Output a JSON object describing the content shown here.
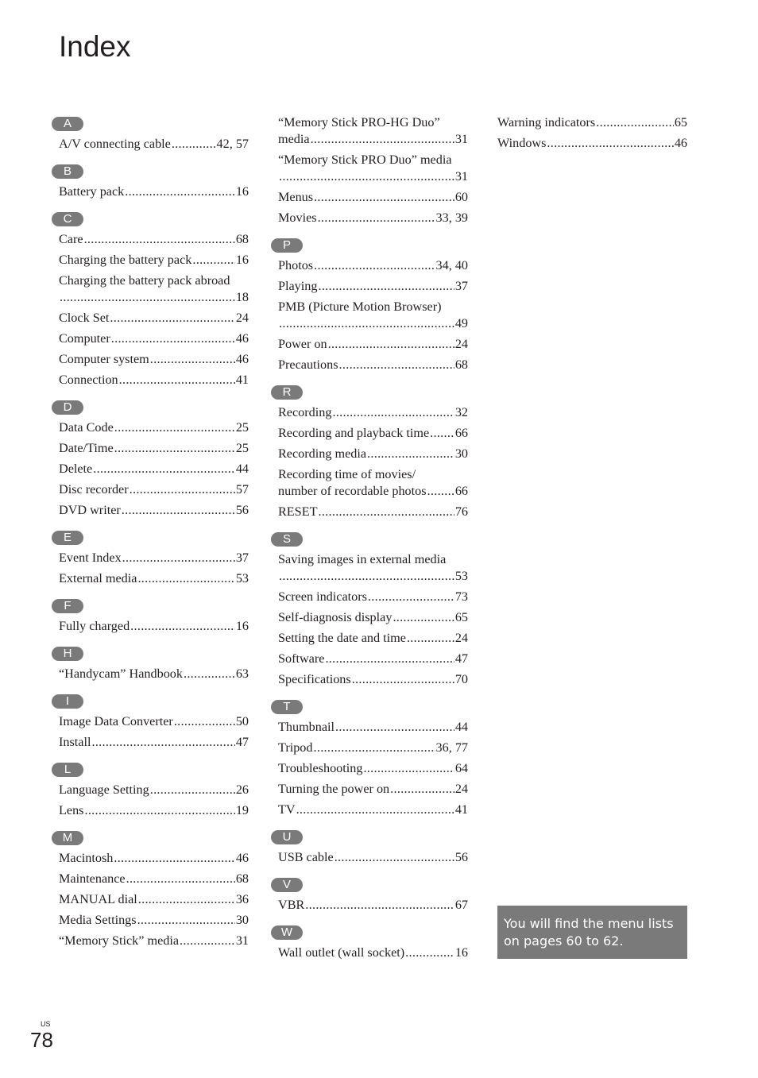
{
  "title": "Index",
  "columns": [
    {
      "sections": [
        {
          "letter": "A",
          "entries": [
            {
              "term": "A/V connecting cable",
              "page": "42, 57"
            }
          ]
        },
        {
          "letter": "B",
          "entries": [
            {
              "term": "Battery pack",
              "page": "16"
            }
          ]
        },
        {
          "letter": "C",
          "entries": [
            {
              "term": "Care",
              "page": "68"
            },
            {
              "term": "Charging the battery pack",
              "page": "16"
            },
            {
              "term": "Charging the battery pack abroad",
              "page": "18",
              "wrap": true
            },
            {
              "term": "Clock Set",
              "page": "24"
            },
            {
              "term": "Computer",
              "page": "46"
            },
            {
              "term": "Computer system",
              "page": "46"
            },
            {
              "term": "Connection",
              "page": "41"
            }
          ]
        },
        {
          "letter": "D",
          "entries": [
            {
              "term": "Data Code",
              "page": "25"
            },
            {
              "term": "Date/Time",
              "page": "25"
            },
            {
              "term": "Delete",
              "page": "44"
            },
            {
              "term": "Disc recorder",
              "page": "57"
            },
            {
              "term": "DVD writer",
              "page": "56"
            }
          ]
        },
        {
          "letter": "E",
          "entries": [
            {
              "term": "Event Index",
              "page": "37"
            },
            {
              "term": "External media",
              "page": "53"
            }
          ]
        },
        {
          "letter": "F",
          "entries": [
            {
              "term": "Fully charged",
              "page": "16"
            }
          ]
        },
        {
          "letter": "H",
          "entries": [
            {
              "term": "“Handycam” Handbook",
              "page": "63"
            }
          ]
        },
        {
          "letter": "I",
          "entries": [
            {
              "term": "Image Data Converter",
              "page": "50"
            },
            {
              "term": "Install",
              "page": "47"
            }
          ]
        },
        {
          "letter": "L",
          "entries": [
            {
              "term": "Language Setting",
              "page": "26"
            },
            {
              "term": "Lens",
              "page": "19"
            }
          ]
        },
        {
          "letter": "M",
          "entries": [
            {
              "term": "Macintosh",
              "page": "46"
            },
            {
              "term": "Maintenance",
              "page": "68"
            },
            {
              "term": "MANUAL dial",
              "page": "36"
            },
            {
              "term": "Media Settings",
              "page": "30"
            },
            {
              "term": "“Memory Stick” media",
              "page": "31"
            }
          ]
        }
      ]
    },
    {
      "sections": [
        {
          "letter": "",
          "entries": [
            {
              "term": "“Memory Stick PRO-HG Duo”",
              "term2": "media",
              "page": "31",
              "wrap": true
            },
            {
              "term": "“Memory Stick PRO Duo” media",
              "page": "31",
              "wrap": true
            },
            {
              "term": "Menus",
              "page": "60"
            },
            {
              "term": "Movies",
              "page": "33, 39"
            }
          ]
        },
        {
          "letter": "P",
          "entries": [
            {
              "term": "Photos",
              "page": "34, 40"
            },
            {
              "term": "Playing",
              "page": "37"
            },
            {
              "term": "PMB (Picture Motion Browser)",
              "page": "49",
              "wrap": true
            },
            {
              "term": "Power on",
              "page": "24"
            },
            {
              "term": "Precautions",
              "page": "68"
            }
          ]
        },
        {
          "letter": "R",
          "entries": [
            {
              "term": "Recording",
              "page": "32"
            },
            {
              "term": "Recording and playback time",
              "page": "66"
            },
            {
              "term": "Recording media",
              "page": "30"
            },
            {
              "term": "Recording time of movies/",
              "term2": "number of recordable photos",
              "page": "66",
              "wrap": true
            },
            {
              "term": "RESET",
              "page": "76"
            }
          ]
        },
        {
          "letter": "S",
          "entries": [
            {
              "term": "Saving images in external media",
              "page": "53",
              "wrap": true
            },
            {
              "term": "Screen indicators",
              "page": "73"
            },
            {
              "term": "Self-diagnosis display",
              "page": "65"
            },
            {
              "term": "Setting the date and time",
              "page": "24"
            },
            {
              "term": "Software",
              "page": "47"
            },
            {
              "term": "Specifications",
              "page": "70"
            }
          ]
        },
        {
          "letter": "T",
          "entries": [
            {
              "term": "Thumbnail",
              "page": "44"
            },
            {
              "term": "Tripod",
              "page": "36, 77"
            },
            {
              "term": "Troubleshooting",
              "page": "64"
            },
            {
              "term": "Turning the power on",
              "page": "24"
            },
            {
              "term": "TV",
              "page": "41"
            }
          ]
        },
        {
          "letter": "U",
          "entries": [
            {
              "term": "USB cable",
              "page": "56"
            }
          ]
        },
        {
          "letter": "V",
          "entries": [
            {
              "term": "VBR",
              "page": "67"
            }
          ]
        },
        {
          "letter": "W",
          "entries": [
            {
              "term": "Wall outlet (wall socket)",
              "page": "16"
            }
          ]
        }
      ]
    },
    {
      "sections": [
        {
          "letter": "",
          "entries": [
            {
              "term": "Warning indicators",
              "page": "65"
            },
            {
              "term": "Windows",
              "page": "46"
            }
          ]
        }
      ]
    }
  ],
  "note": "You will find the menu lists on pages 60 to 62.",
  "footer": {
    "region": "US",
    "page_number": "78"
  }
}
